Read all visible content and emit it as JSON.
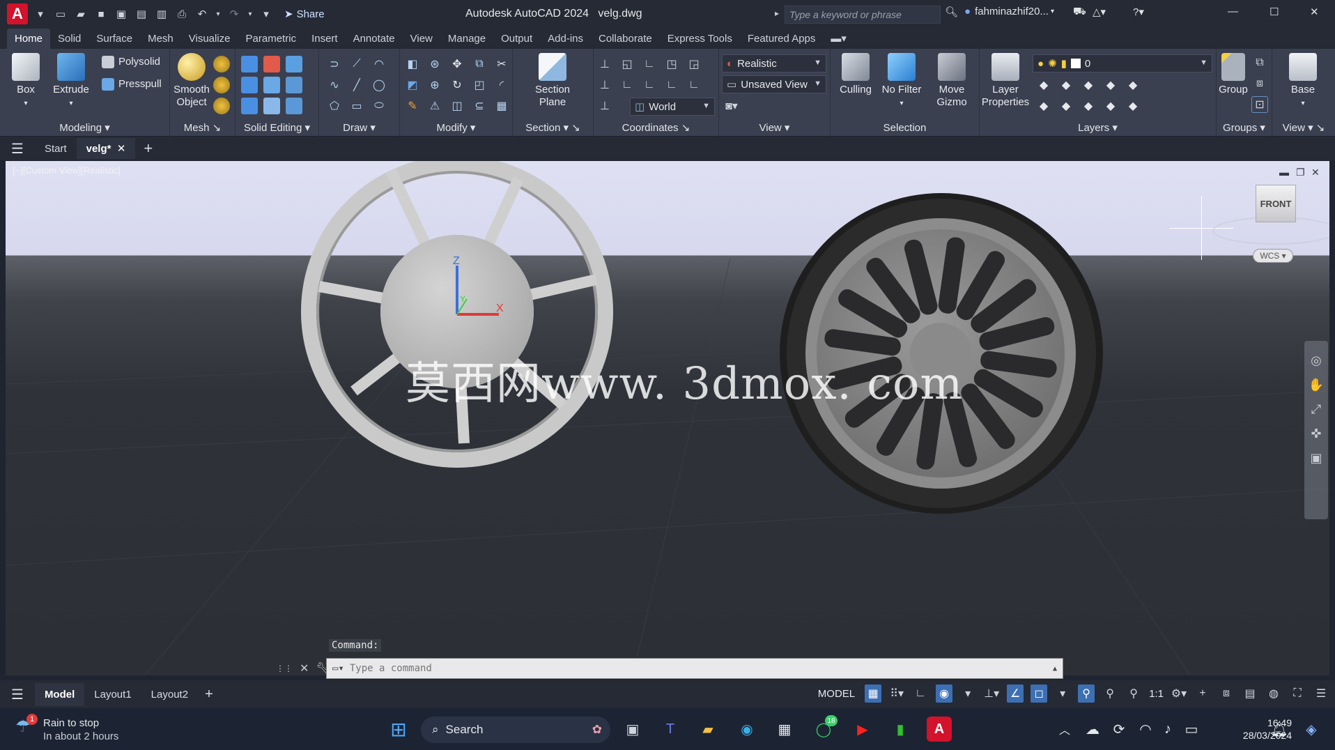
{
  "app": {
    "title": "Autodesk AutoCAD 2024",
    "filename": "velg.dwg",
    "share_label": "Share",
    "search_placeholder": "Type a keyword or phrase",
    "user": "fahminazhif20..."
  },
  "tabs": [
    "Home",
    "Solid",
    "Surface",
    "Mesh",
    "Visualize",
    "Parametric",
    "Insert",
    "Annotate",
    "View",
    "Manage",
    "Output",
    "Add-ins",
    "Collaborate",
    "Express Tools",
    "Featured Apps"
  ],
  "ribbon": {
    "modeling": {
      "label": "Modeling",
      "box": "Box",
      "extrude": "Extrude",
      "polysolid": "Polysolid",
      "presspull": "Presspull"
    },
    "mesh": {
      "label": "Mesh",
      "smooth_line1": "Smooth",
      "smooth_line2": "Object"
    },
    "solid_editing": {
      "label": "Solid Editing"
    },
    "draw": {
      "label": "Draw"
    },
    "modify": {
      "label": "Modify"
    },
    "section": {
      "label": "Section",
      "plane_line1": "Section",
      "plane_line2": "Plane"
    },
    "coordinates": {
      "label": "Coordinates",
      "world": "World"
    },
    "view": {
      "label": "View",
      "visual_style": "Realistic",
      "named_view": "Unsaved View"
    },
    "selection": {
      "label": "Selection",
      "culling": "Culling",
      "no_filter": "No Filter",
      "move_line1": "Move",
      "move_line2": "Gizmo"
    },
    "layers": {
      "label": "Layers",
      "layer_line1": "Layer",
      "layer_line2": "Properties",
      "current_layer": "0"
    },
    "groups": {
      "label": "Groups",
      "group": "Group"
    },
    "viewpanel": {
      "label": "View",
      "base": "Base"
    }
  },
  "doctabs": {
    "start": "Start",
    "file": "velg*"
  },
  "viewport": {
    "caption": "[−][Custom View][Realistic]",
    "viewcube": "FRONT",
    "wcs": "WCS",
    "watermark": "莫西网www. 3dmox. com",
    "axis_z": "Z",
    "axis_x": "X",
    "axis_y": "Y"
  },
  "command": {
    "history": "Command:",
    "placeholder": "Type a command"
  },
  "status": {
    "layouts": [
      "Model",
      "Layout1",
      "Layout2"
    ],
    "model": "MODEL",
    "scale": "1:1"
  },
  "taskbar": {
    "weather_line1": "Rain to stop",
    "weather_line2": "In about 2 hours",
    "weather_badge": "1",
    "search": "Search",
    "time": "16:49",
    "date": "28/03/2024",
    "whatsapp_badge": "18"
  },
  "colors": {
    "accent": "#3d6fb3",
    "autocad_red": "#d3122b",
    "viewport_sky": "#dfe0f2",
    "viewport_ground": "#2c2f36"
  }
}
